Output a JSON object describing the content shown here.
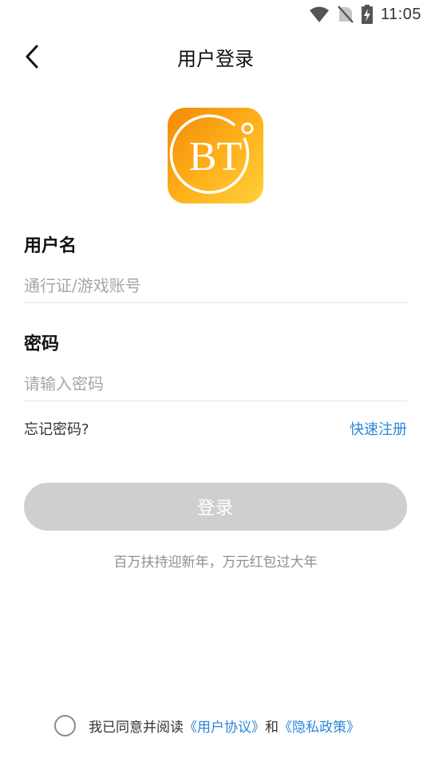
{
  "status_bar": {
    "time": "11:05",
    "icons": [
      "wifi-icon",
      "no-sim-icon",
      "battery-charging-icon"
    ]
  },
  "header": {
    "title": "用户登录",
    "back_icon": "chevron-left-icon"
  },
  "logo": {
    "text": "BT",
    "colors": {
      "primary": "#f59a0c",
      "secondary": "#ffc62a"
    }
  },
  "form": {
    "username": {
      "label": "用户名",
      "value": "",
      "placeholder": "通行证/游戏账号"
    },
    "password": {
      "label": "密码",
      "value": "",
      "placeholder": "请输入密码"
    },
    "forgot_label": "忘记密码?",
    "register_label": "快速注册",
    "login_label": "登录"
  },
  "promo": {
    "text": "百万扶持迎新年，万元红包过大年"
  },
  "agreement": {
    "checked": false,
    "prefix": "我已同意并阅读",
    "user_agreement": "《用户协议》",
    "conjunction": "和",
    "privacy_policy": "《隐私政策》"
  },
  "colors": {
    "link": "#2b86d9",
    "button_disabled": "#cfcfcf",
    "placeholder": "#a6a6a6"
  }
}
